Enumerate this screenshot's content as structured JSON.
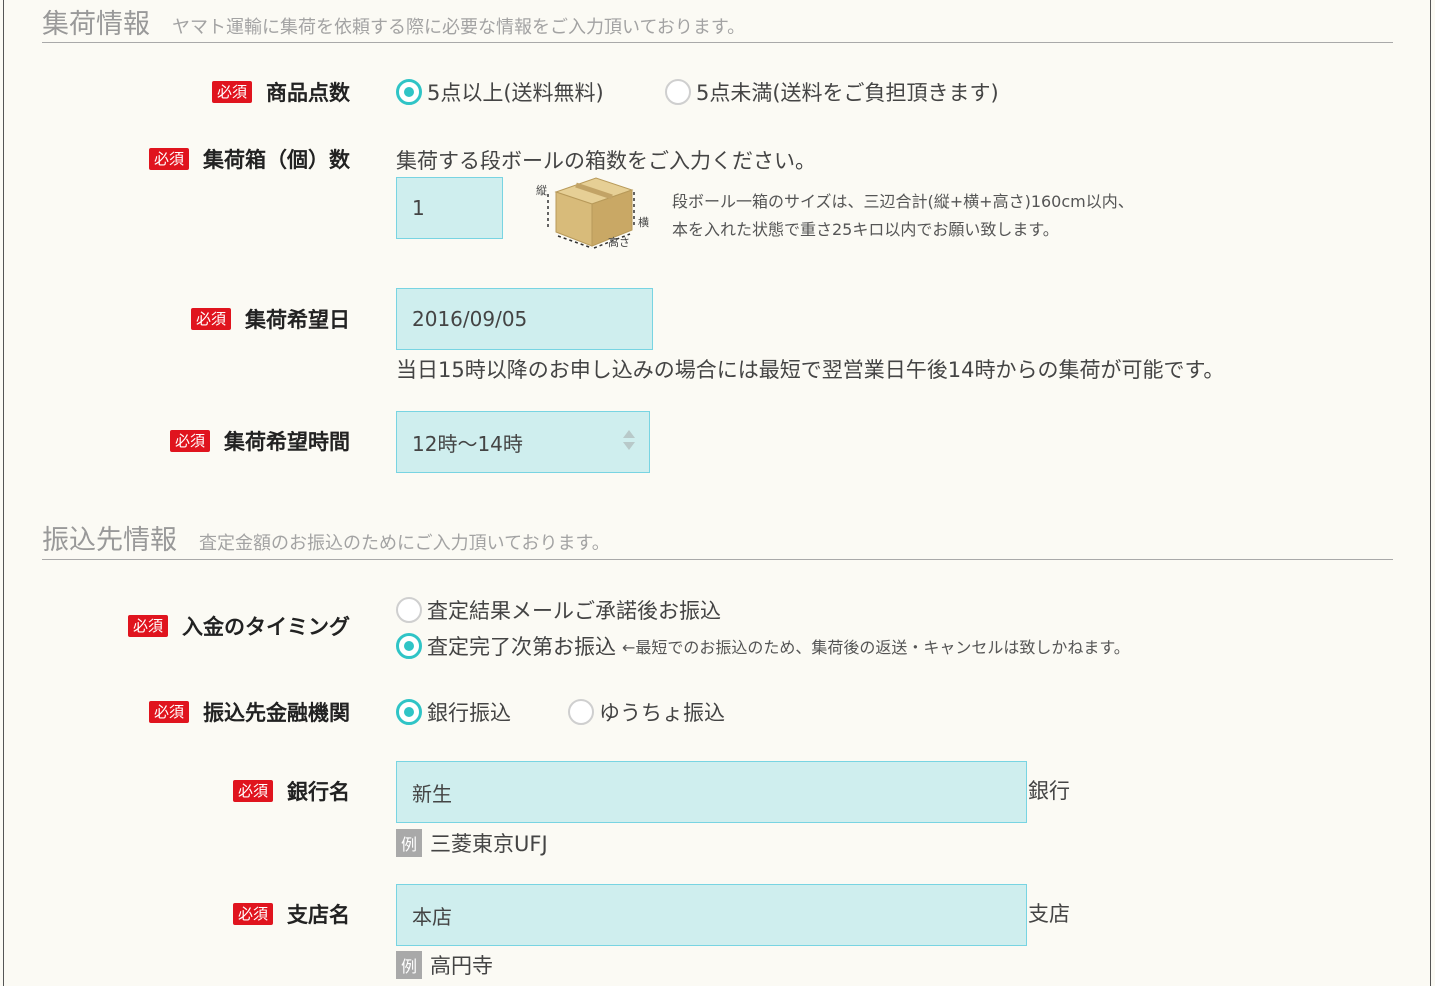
{
  "collection_section": {
    "title": "集荷情報",
    "subtitle": "ヤマト運輸に集荷を依頼する際に必要な情報をご入力頂いております。"
  },
  "required_badge": "必須",
  "item_count": {
    "label": "商品点数",
    "options": [
      {
        "label": "5点以上(送料無料)",
        "selected": true
      },
      {
        "label": "5点未満(送料をご負担頂きます)",
        "selected": false
      }
    ]
  },
  "box_count": {
    "label": "集荷箱（個）数",
    "instruction": "集荷する段ボールの箱数をご入力ください。",
    "value": "1",
    "image_labels": {
      "tate": "縦",
      "yoko": "横",
      "takasa": "高さ"
    },
    "size_note_line1": "段ボール一箱のサイズは、三辺合計(縦+横+高さ)160cm以内、",
    "size_note_line2": "本を入れた状態で重さ25キロ以内でお願い致します。"
  },
  "pickup_date": {
    "label": "集荷希望日",
    "value": "2016/09/05",
    "note": "当日15時以降のお申し込みの場合には最短で翌営業日午後14時からの集荷が可能です。"
  },
  "pickup_time": {
    "label": "集荷希望時間",
    "value": "12時～14時"
  },
  "transfer_section": {
    "title": "振込先情報",
    "subtitle": "査定金額のお振込のためにご入力頂いております。"
  },
  "payment_timing": {
    "label": "入金のタイミング",
    "options": [
      {
        "label": "査定結果メールご承諾後お振込",
        "selected": false,
        "note": ""
      },
      {
        "label": "査定完了次第お振込",
        "selected": true,
        "note": "←最短でのお振込のため、集荷後の返送・キャンセルは致しかねます。"
      }
    ]
  },
  "financial_institution": {
    "label": "振込先金融機関",
    "options": [
      {
        "label": "銀行振込",
        "selected": true
      },
      {
        "label": "ゆうちょ振込",
        "selected": false
      }
    ]
  },
  "bank_name": {
    "label": "銀行名",
    "value": "新生",
    "suffix": "銀行",
    "example_badge": "例",
    "example": "三菱東京UFJ"
  },
  "branch_name": {
    "label": "支店名",
    "value": "本店",
    "suffix": "支店",
    "example_badge": "例",
    "example": "高円寺"
  },
  "colors": {
    "required_badge": "#e0141e",
    "radio_selected": "#2fc4c6",
    "input_background": "#cfeeee",
    "input_border": "#78d4e2",
    "page_background": "#fbfaf4"
  }
}
